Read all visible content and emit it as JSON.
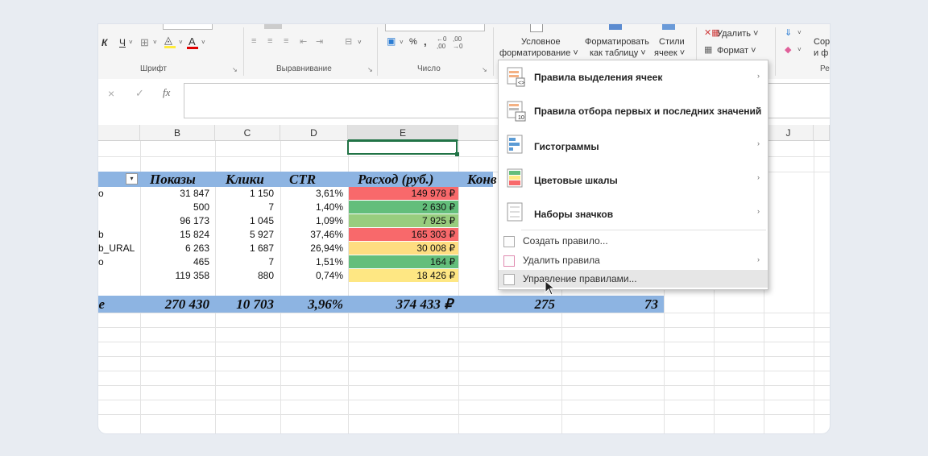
{
  "ribbon": {
    "font_group": "Шрифт",
    "align_group": "Выравнивание",
    "number_group": "Число",
    "cond_format_line1": "Условное",
    "cond_format_line2": "форматирование ˅",
    "format_table_line1": "Форматировать",
    "format_table_line2": "как таблицу ˅",
    "styles_line1": "Стили",
    "styles_line2": "ячеек ˅",
    "delete_label": "Удалить ˅",
    "format_label": "Формат ˅",
    "sort_line1": "Сор",
    "sort_line2": "и ф",
    "edit_group": "Ре",
    "bold": "К",
    "underline": "Ч",
    "percent": "%",
    "thousands": "000"
  },
  "formula_bar": {
    "cancel": "×",
    "enter": "✓",
    "fx": "fx",
    "value": ""
  },
  "columns": [
    "B",
    "C",
    "D",
    "E",
    "J"
  ],
  "table": {
    "headers": {
      "filter": "▾",
      "impressions": "Показы",
      "clicks": "Клики",
      "ctr": "CTR",
      "spend": "Расход (руб.)",
      "conv": "Конв"
    },
    "rows": [
      {
        "name": "o",
        "impressions": "31 847",
        "clicks": "1 150",
        "ctr": "3,61%",
        "spend": "149 978 ₽",
        "color": "#f8696b"
      },
      {
        "name": "",
        "impressions": "500",
        "clicks": "7",
        "ctr": "1,40%",
        "spend": "2 630 ₽",
        "color": "#63be7b"
      },
      {
        "name": "",
        "impressions": "96 173",
        "clicks": "1 045",
        "ctr": "1,09%",
        "spend": "7 925 ₽",
        "color": "#98cd7e"
      },
      {
        "name": "b",
        "impressions": "15 824",
        "clicks": "5 927",
        "ctr": "37,46%",
        "spend": "165 303 ₽",
        "color": "#f8696b"
      },
      {
        "name": "b_URAL",
        "impressions": "6 263",
        "clicks": "1 687",
        "ctr": "26,94%",
        "spend": "30 008 ₽",
        "color": "#fedd81"
      },
      {
        "name": "o",
        "impressions": "465",
        "clicks": "7",
        "ctr": "1,51%",
        "spend": "164 ₽",
        "color": "#63be7b"
      },
      {
        "name": "",
        "impressions": "119 358",
        "clicks": "880",
        "ctr": "0,74%",
        "spend": "18 426 ₽",
        "color": "#fee783"
      }
    ],
    "totals": {
      "name": "e",
      "impressions": "270 430",
      "clicks": "10 703",
      "ctr": "3,96%",
      "spend": "374 433 ₽",
      "conv": "275",
      "last": "73"
    }
  },
  "menu": {
    "items": [
      {
        "label": "Правила выделения ячеек",
        "arrow": "›"
      },
      {
        "label": "Правила отбора первых и последних значений",
        "arrow": "›"
      },
      {
        "label": "Гистограммы",
        "arrow": "›"
      },
      {
        "label": "Цветовые шкалы",
        "arrow": "›"
      },
      {
        "label": "Наборы значков",
        "arrow": "›"
      }
    ],
    "sub_items": [
      {
        "label": "Создать правило...",
        "arrow": ""
      },
      {
        "label": "Удалить правила",
        "arrow": "›"
      },
      {
        "label": "Управление правилами...",
        "arrow": ""
      }
    ],
    "top10_badge": "10"
  }
}
